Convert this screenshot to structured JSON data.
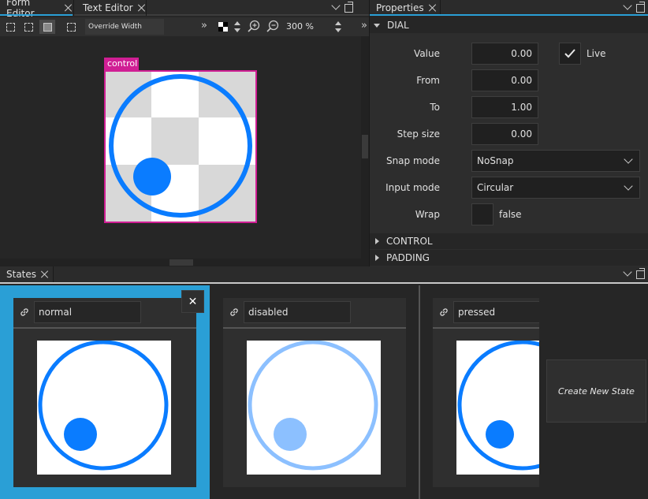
{
  "form_editor_tabs": [
    {
      "label": "Form Editor",
      "active": true
    },
    {
      "label": "Text Editor",
      "active": false
    }
  ],
  "toolbar": {
    "override_width": "Override Width",
    "zoom": "300 %",
    "overflow": "»"
  },
  "canvas": {
    "control_label": "control",
    "control_style": {
      "ring_color": "#0a7cff",
      "handle_color": "#0a7cff",
      "checker_light": "#ffffff",
      "checker_dark": "#d8d8d8"
    }
  },
  "properties": {
    "tab_label": "Properties",
    "section_dial": "DIAL",
    "fields": {
      "value": {
        "label": "Value",
        "value": "0.00"
      },
      "from": {
        "label": "From",
        "value": "0.00"
      },
      "to": {
        "label": "To",
        "value": "1.00"
      },
      "step_size": {
        "label": "Step size",
        "value": "0.00"
      },
      "snap_mode": {
        "label": "Snap mode",
        "value": "NoSnap"
      },
      "input_mode": {
        "label": "Input mode",
        "value": "Circular"
      },
      "wrap": {
        "label": "Wrap",
        "value": "false",
        "checked": false
      }
    },
    "live": {
      "label": "Live",
      "checked": true
    },
    "section_control": "CONTROL",
    "section_padding": "PADDING"
  },
  "states": {
    "tab_label": "States",
    "items": [
      {
        "name": "normal",
        "selected": true
      },
      {
        "name": "disabled",
        "selected": false
      },
      {
        "name": "pressed",
        "selected": false
      }
    ],
    "close_glyph": "✕",
    "create_label": "Create New State"
  },
  "colors": {
    "accent": "#2a9fd6",
    "control_outline": "#d01e94",
    "dial_blue": "#0a7cff",
    "dial_disabled": "#8cc0ff"
  },
  "icons": [
    "close-icon",
    "chevron-down-icon",
    "float-icon",
    "link-icon",
    "checkmark-icon",
    "zoom-in-icon",
    "zoom-out-icon"
  ]
}
